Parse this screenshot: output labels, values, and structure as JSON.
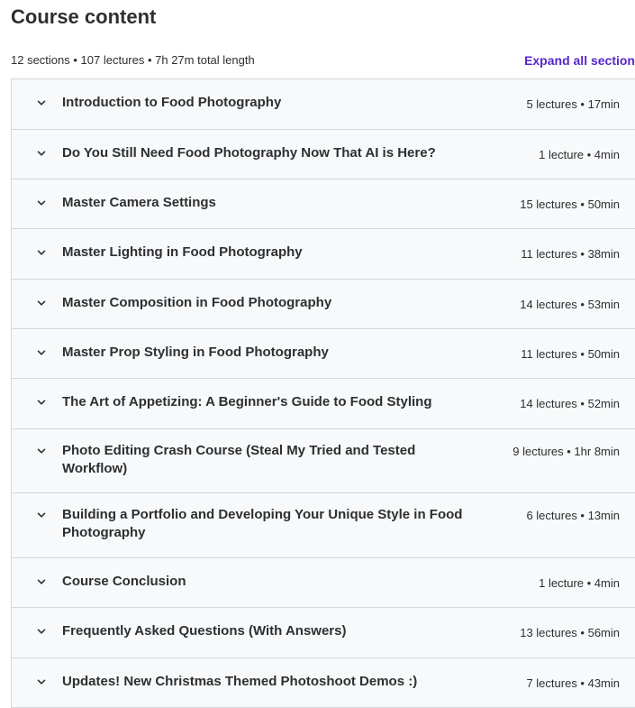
{
  "header": {
    "title": "Course content"
  },
  "summary": {
    "text": "12 sections • 107 lectures • 7h 27m total length",
    "expand_label": "Expand all section"
  },
  "sections": [
    {
      "title": "Introduction to Food Photography",
      "meta": "5 lectures • 17min"
    },
    {
      "title": "Do You Still Need Food Photography Now That AI is Here?",
      "meta": "1 lecture • 4min"
    },
    {
      "title": "Master Camera Settings",
      "meta": "15 lectures • 50min"
    },
    {
      "title": "Master Lighting in Food Photography",
      "meta": "11 lectures • 38min"
    },
    {
      "title": "Master Composition in Food Photography",
      "meta": "14 lectures • 53min"
    },
    {
      "title": "Master Prop Styling in Food Photography",
      "meta": "11 lectures • 50min"
    },
    {
      "title": "The Art of Appetizing: A Beginner's Guide to Food Styling",
      "meta": "14 lectures • 52min"
    },
    {
      "title": "Photo Editing Crash Course (Steal My Tried and Tested Workflow)",
      "meta": "9 lectures • 1hr 8min"
    },
    {
      "title": "Building a Portfolio and Developing Your Unique Style in Food Photography",
      "meta": "6 lectures • 13min"
    },
    {
      "title": "Course Conclusion",
      "meta": "1 lecture • 4min"
    },
    {
      "title": "Frequently Asked Questions (With Answers)",
      "meta": "13 lectures • 56min"
    },
    {
      "title": "Updates! New Christmas Themed Photoshoot Demos :)",
      "meta": "7 lectures • 43min"
    }
  ],
  "colors": {
    "text": "#2d2f31",
    "accent": "#5624d0",
    "row_bg": "#f7f9fa",
    "border": "#d1d7dc"
  },
  "icons": {
    "section_toggle": "chevron-down-icon"
  }
}
